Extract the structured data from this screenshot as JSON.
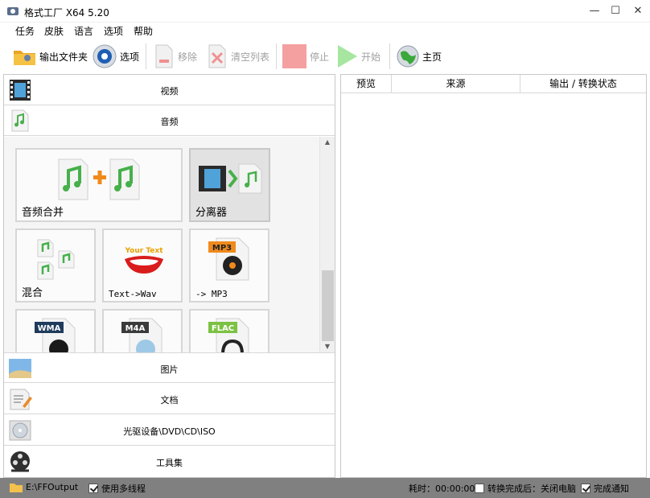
{
  "window": {
    "title": "格式工厂 X64 5.20"
  },
  "menu": [
    "任务",
    "皮肤",
    "语言",
    "选项",
    "帮助"
  ],
  "toolbar": {
    "output_folder": "输出文件夹",
    "options": "选项",
    "remove": "移除",
    "clear_list": "清空列表",
    "stop": "停止",
    "start": "开始",
    "home": "主页"
  },
  "categories": {
    "video": "视频",
    "audio": "音频",
    "image": "图片",
    "document": "文档",
    "optical": "光驱设备\\DVD\\CD\\ISO",
    "tools": "工具集"
  },
  "audio_tiles": {
    "merge": "音频合并",
    "splitter": "分离器",
    "mix": "混合",
    "text_wav": "Text->Wav",
    "to_mp3": "-> MP3",
    "wma": "WMA",
    "m4a": "M4A",
    "flac": "FLAC",
    "mp3": "MP3",
    "your_text": "Your Text"
  },
  "table": {
    "headers": [
      "预览",
      "来源",
      "输出 / 转换状态"
    ]
  },
  "status": {
    "output_path": "E:\\FFOutput",
    "multithread": "使用多线程",
    "elapsed": "耗时：00:00:00",
    "after_done": "转换完成后：关闭电脑",
    "notify": "完成通知"
  },
  "colors": {
    "accent_green": "#5cc85c",
    "stop_red": "#f4a0a0",
    "status_bg": "#808080"
  }
}
